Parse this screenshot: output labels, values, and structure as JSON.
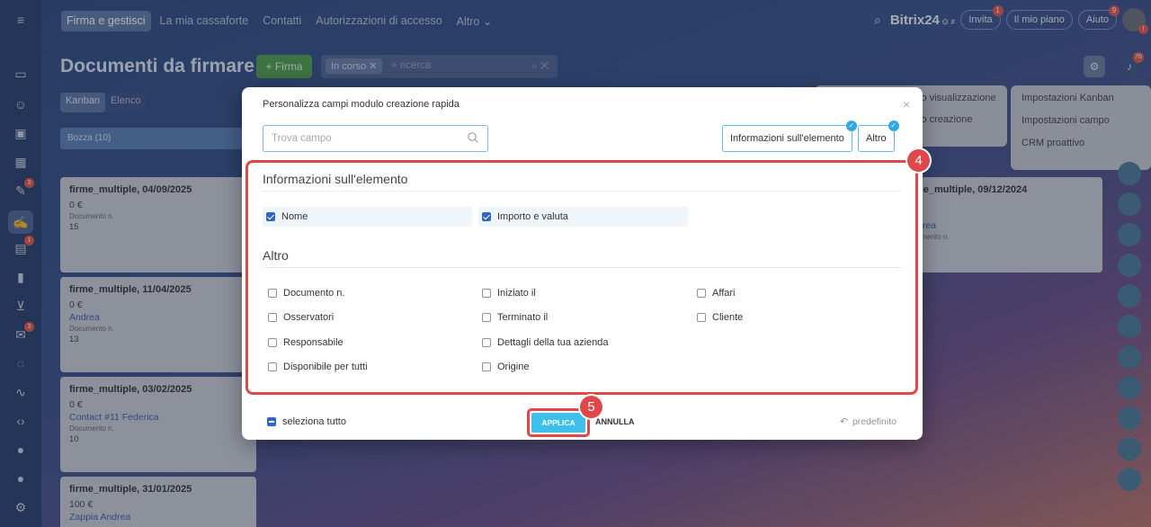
{
  "topbar": {
    "nav": [
      "Firma e gestisci",
      "La mia cassaforte",
      "Contatti",
      "Autorizzazioni di accesso",
      "Altro"
    ],
    "brand": "Bitrix",
    "brand_num": "24",
    "invite_label": "Invita",
    "invite_badge": "1",
    "plan_label": "Il mio piano",
    "help_label": "Aiuto",
    "help_badge": "9"
  },
  "page": {
    "title": "Documenti da firmare",
    "firma_button": "+ Firma",
    "filter_tag": "In corso",
    "filter_placeholder": "+ ricerca",
    "view_tabs": [
      "Kanban",
      "Elenco"
    ],
    "notif_badge": "76"
  },
  "kanban": {
    "column_title": "Bozza",
    "column_count": "(10)",
    "cards": [
      {
        "title": "firme_multiple, 04/09/2025",
        "value": "0 €",
        "link": "",
        "sub": "Documento n.",
        "num": "15"
      },
      {
        "title": "firme_multiple, 11/04/2025",
        "value": "0 €",
        "link": "Andrea",
        "sub": "Documento n.",
        "num": "13"
      },
      {
        "title": "firme_multiple, 03/02/2025",
        "value": "0 €",
        "link": "Contact #11 Federica",
        "sub": "Documento n.",
        "num": "10"
      },
      {
        "title": "firme_multiple, 31/01/2025",
        "value": "100 €",
        "link": "Zappia Andrea",
        "sub": "",
        "num": ""
      }
    ],
    "right_card": {
      "title": "ne_multiple, 09/12/2024",
      "link": "drea",
      "sub": "umento n."
    }
  },
  "bg_menus": {
    "menu1": [
      "lo visualizzazione",
      "lo creazione"
    ],
    "menu2": [
      "Impostazioni Kanban",
      "Impostazioni campo",
      "CRM proattivo"
    ]
  },
  "modal": {
    "title": "Personalizza campi modulo creazione rapida",
    "search_placeholder": "Trova campo",
    "section_buttons": [
      "Informazioni sull'elemento",
      "Altro"
    ],
    "sections": [
      {
        "title": "Informazioni sull'elemento",
        "fields": [
          {
            "label": "Nome",
            "checked": true
          },
          {
            "label": "Importo e valuta",
            "checked": true
          }
        ]
      },
      {
        "title": "Altro",
        "fields": [
          {
            "label": "Documento n.",
            "checked": false
          },
          {
            "label": "Iniziato il",
            "checked": false
          },
          {
            "label": "Affari",
            "checked": false
          },
          {
            "label": "Osservatori",
            "checked": false
          },
          {
            "label": "Terminato il",
            "checked": false
          },
          {
            "label": "Cliente",
            "checked": false
          },
          {
            "label": "Responsabile",
            "checked": false
          },
          {
            "label": "Dettagli della tua azienda",
            "checked": false
          },
          {
            "label": "Disponibile per tutti",
            "checked": false
          },
          {
            "label": "Origine",
            "checked": false
          }
        ]
      }
    ],
    "select_all": "seleziona tutto",
    "apply": "APPLICA",
    "cancel": "ANNULLA",
    "default": "predefinito"
  },
  "steps": {
    "step4": "4",
    "step5": "5"
  }
}
